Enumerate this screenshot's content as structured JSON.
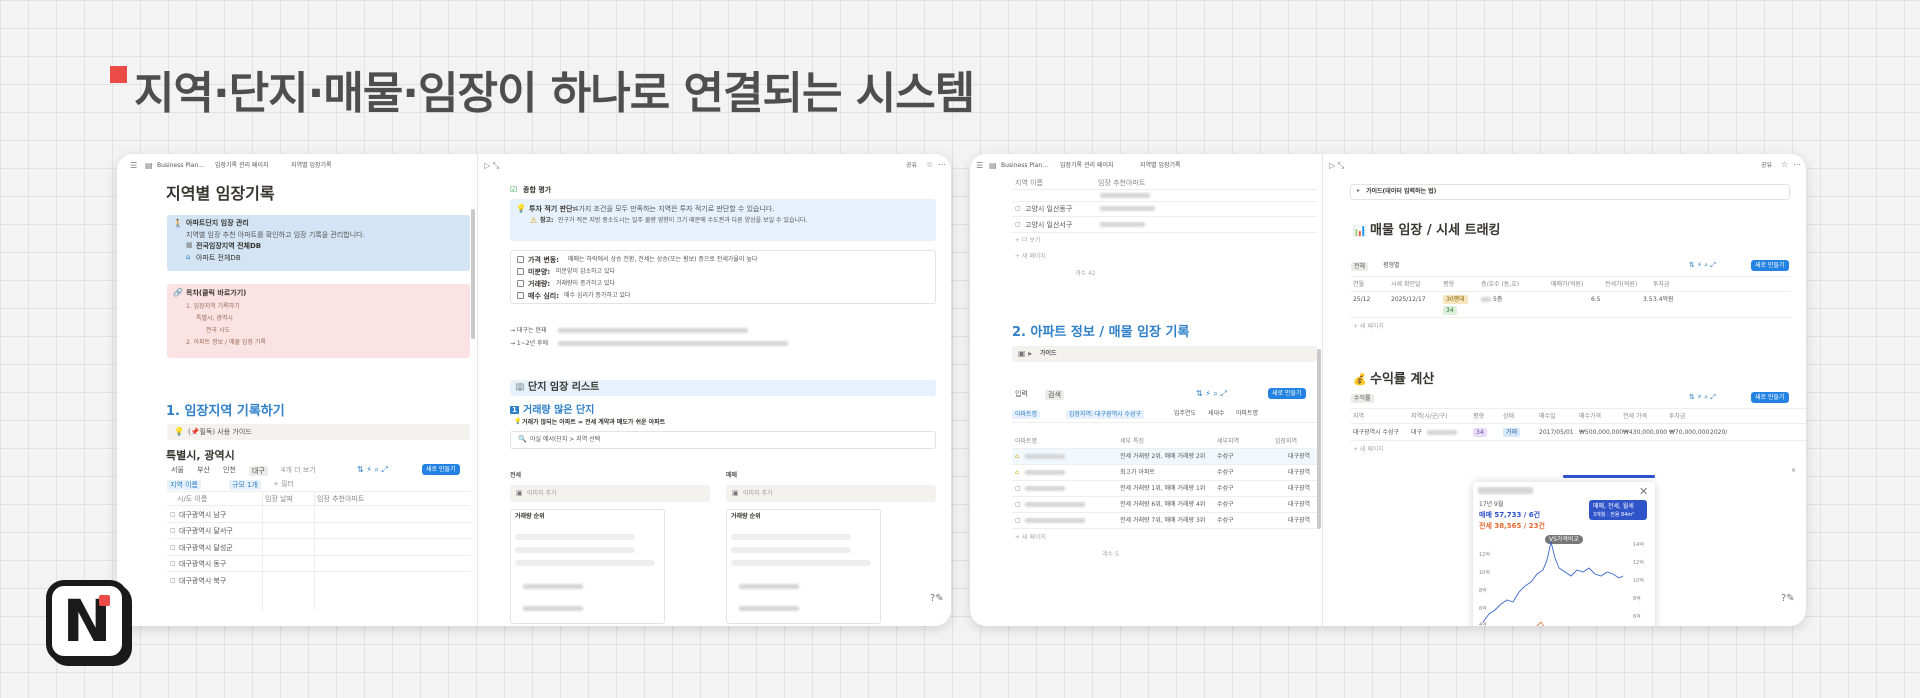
{
  "headline": "지역·단지·매물·임장이 하나로 연결되는 시스템",
  "logo": {
    "letter": "N"
  },
  "card1": {
    "breadcrumb": [
      "Business Plan",
      "...",
      "임장기록 관리 페이지",
      "지역별 임장기록"
    ],
    "share": "공유",
    "left": {
      "title": "지역별 임장기록",
      "callout": {
        "title": "아파트단지 임장 관리",
        "desc": "지역별 임장 추천 아파트를 확인하고 임장 기록을 관리합니다.",
        "link1": "전국임장지역 전체DB",
        "link2": "아파트 전체DB"
      },
      "toc": {
        "title": "목차(클릭 바로가기)",
        "items": [
          "1. 임장지역 기록하기",
          "특별시, 광역시",
          "전국 시도",
          "2. 아파트 정보 / 매물 임장 기록"
        ]
      },
      "section1": "1. 임장지역 기록하기",
      "guide": "(📌필독) 사용 가이드",
      "subsection": "특별시, 광역시",
      "tabs": [
        "서울",
        "부산",
        "인천",
        "대구",
        "4개 더 보기"
      ],
      "new_button": "새로 만들기",
      "filters": [
        "지역 이름",
        "규모 1개",
        "+ 필터"
      ],
      "columns": [
        "시/도 이름",
        "임장 날짜",
        "임장 추천아파트"
      ],
      "rows": [
        "대구광역시 남구",
        "대구광역시 달서구",
        "대구광역시 달성군",
        "대구광역시 동구",
        "대구광역시 북구"
      ]
    },
    "right": {
      "section": "종합 평가",
      "callout_title": "투자 적기 판단:",
      "callout_line1": "4가지 조건을 모두 만족하는 지역은 투자 적기로 판단할 수 있습니다.",
      "callout_note": "참고:",
      "callout_line2": "인구가 적은 지방 중소도시는 일주 물량 영향이 크기 때문에 수도권과 다른 양상을 보일 수 있습니다.",
      "checks": [
        {
          "label": "가격 변동:",
          "text": "매매는 하락에서 상승 전환, 전세는 상승(또는 횡보) 중으로 전세가율이 높다"
        },
        {
          "label": "미분양:",
          "text": "미분양이 감소하고 있다"
        },
        {
          "label": "거래량:",
          "text": "거래량이 증가하고 있다"
        },
        {
          "label": "매수 심리:",
          "text": "매수 심리가 증가하고 있다"
        }
      ],
      "note1": "→ 대구는 현재",
      "note2": "→ 1~2년 후에",
      "list_title": "단지 임장 리스트",
      "sub_title": "거래량 많은 단지",
      "sub_note": "거래가 많되는 아파트 = 전세 계약과 매도가 쉬운 아파트",
      "search_hint": "아실 에서(단지 > 지역 선택",
      "col_left": "전세",
      "col_right": "매매",
      "add_image": "이미지 추가",
      "rank_title": "거래량 순위"
    }
  },
  "card2": {
    "breadcrumb": [
      "Business Plan",
      "...",
      "임장기록 관리 페이지",
      "지역별 임장기록"
    ],
    "share": "공유",
    "left": {
      "columns": [
        "지역 이름",
        "임장 추천아파트"
      ],
      "rows": [
        "고양시 일산동구",
        "고양시 일산서구"
      ],
      "more": "+ 더 보기",
      "new_page": "+ 새 페이지",
      "count": "개수 42",
      "section2": "2. 아파트 정보 / 매물 임장 기록",
      "guide": "가이드",
      "tabs": [
        "입력",
        "검색"
      ],
      "new_button": "새로 만들기",
      "filters": [
        "아파트명",
        "임장지역: 대구광역시 수성구",
        "입주연도",
        "세대수",
        "아파트명"
      ],
      "table_cols": [
        "아파트명",
        "세부 특징",
        "세부지역",
        "임장지역"
      ],
      "table_rows": [
        {
          "feature": "전세 거래량 2위, 매매 거래량 2위",
          "area": "수성구",
          "region": "대구광역"
        },
        {
          "feature": "최고가 아파트",
          "area": "수성구",
          "region": "대구광역"
        },
        {
          "feature": "전세 거래량 1위, 매매 거래량 1위",
          "area": "수성구",
          "region": "대구광역"
        },
        {
          "feature": "전세 거래량 6위, 매매 거래량 4위",
          "area": "수성구",
          "region": "대구광역"
        },
        {
          "feature": "전세 거래량 7위, 매매 거래량 3위",
          "area": "수성구",
          "region": "대구광역"
        }
      ],
      "count2": "개수 5"
    },
    "right": {
      "toggle": "가이드(데이터 입력하는 법)",
      "section1": "매물 임장 / 시세 트래킹",
      "tabs1": [
        "전체",
        "평형별"
      ],
      "new_button": "새로 만들기",
      "cols1": [
        "연월",
        "시세 확인일",
        "평형",
        "층/호수 (동,호)",
        "매매가(억원)",
        "전세가(억원)",
        "투자금"
      ],
      "row1": {
        "ym": "25/12",
        "date": "2025/12/17",
        "size": "30평대",
        "size2": "34",
        "floor": "5층",
        "sale": "6.5",
        "jeonse": "3.5",
        "invest": "3.4억원"
      },
      "new_page": "+ 새 페이지",
      "section2": "수익률 계산",
      "tabs2": [
        "수익률"
      ],
      "cols2": [
        "지역",
        "지역(시/군/구)",
        "평형",
        "상태",
        "매수일",
        "매수가격",
        "전세 가격",
        "투자금"
      ],
      "row2": {
        "region": "대구광역시 수성구",
        "sub": "대구",
        "size": "34",
        "status": "거래",
        "date": "2017/05/01",
        "buy": "₩500,000,000",
        "jeonse": "₩430,000,000",
        "invest": "₩70,000,000",
        "year": "2020/"
      },
      "popup": {
        "period": "17년 9월",
        "sale": "매매 57,733 / 6건",
        "jeonse": "전세 38,565 / 23건",
        "legend": "매매, 전세, 월세",
        "legend2": "3개월 : 전용 84m²",
        "badge": "VS가격비교",
        "yaxis": [
          "14억",
          "12억",
          "10억",
          "8억",
          "6억",
          "4억"
        ]
      }
    }
  },
  "colors": {
    "accent_red": "#ea4b47",
    "notion_blue": "#2382e2",
    "heading_blue": "#2f80c8",
    "callout_blue": "#d3e5f5",
    "callout_pink": "#fbe3e3"
  }
}
